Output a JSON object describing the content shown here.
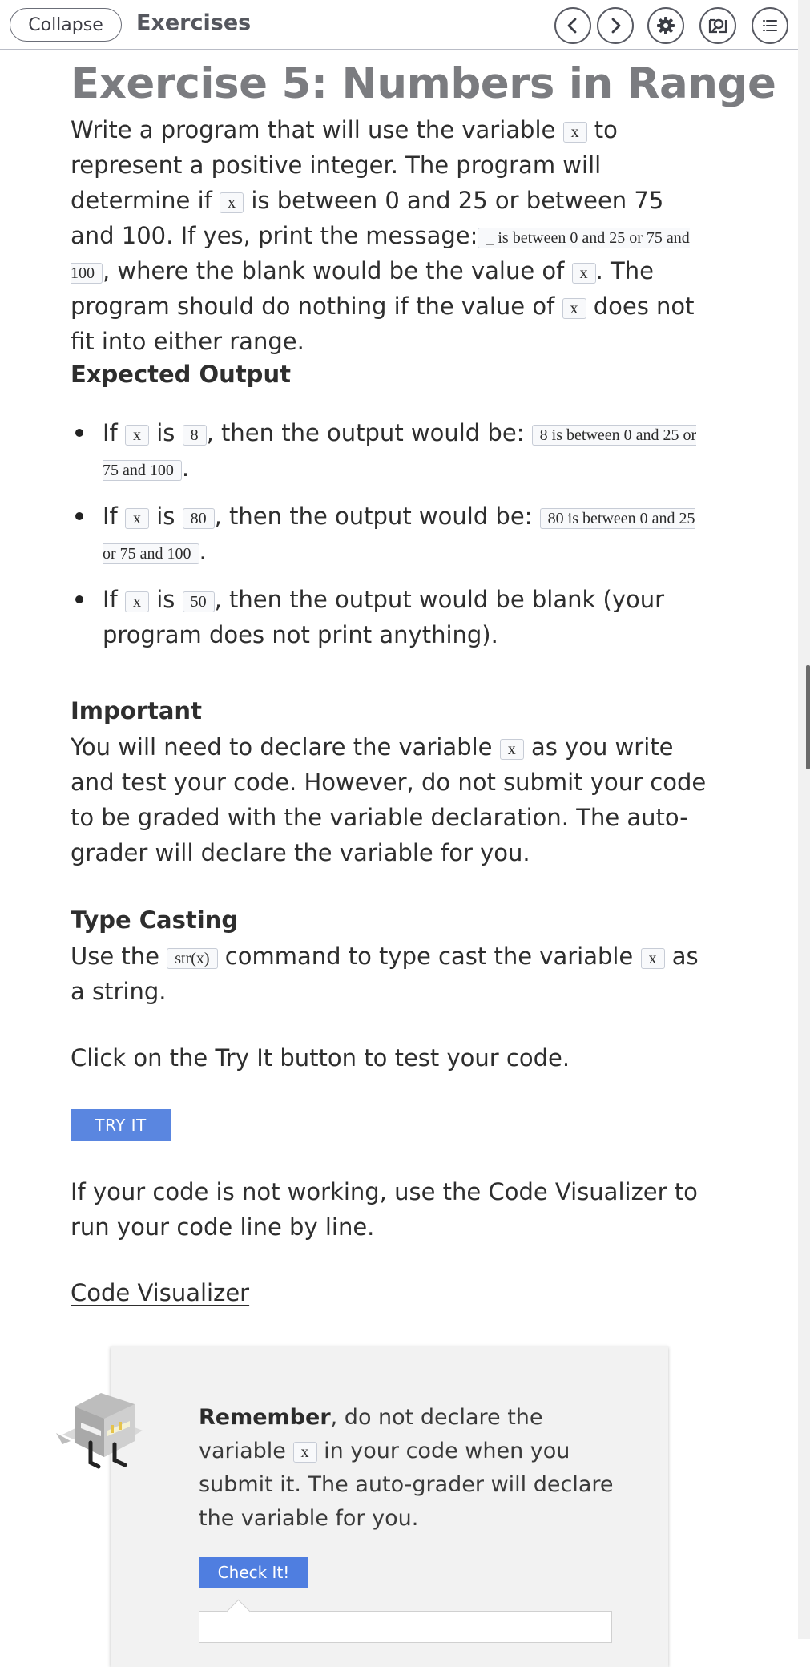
{
  "topbar": {
    "collapse_label": "Collapse",
    "title": "Exercises",
    "icons": [
      "chevron-left-icon",
      "chevron-right-icon",
      "gear-icon",
      "search-book-icon",
      "list-icon"
    ]
  },
  "exercise": {
    "title": "Exercise 5: Numbers in Range",
    "intro": {
      "t1": "Write a program that will use the variable ",
      "c1": "x",
      "t2": " to represent a positive integer. The program will determine if ",
      "c2": "x",
      "t3": " is between 0 and 25 or between 75 and 100. If yes, print the message:",
      "c3": "_ is between 0 and 25 or 75 and 100",
      "t4": ", where the blank would be the value of ",
      "c4": "x",
      "t5": ". The program should do nothing if the value of ",
      "c5": "x",
      "t6": " does not fit into either range."
    },
    "expected_heading": "Expected Output",
    "expected": [
      {
        "if": "If ",
        "var": "x",
        "is": " is ",
        "val": "8",
        "then": ", then the output would be: ",
        "out": "8 is between 0 and 25 or 75 and 100",
        "end": "."
      },
      {
        "if": "If ",
        "var": "x",
        "is": " is ",
        "val": "80",
        "then": ", then the output would be: ",
        "out": "80 is between 0 and 25 or 75 and 100",
        "end": "."
      },
      {
        "if": "If ",
        "var": "x",
        "is": " is ",
        "val": "50",
        "then": ", then the output would be blank (your program does not print anything).",
        "out": "",
        "end": ""
      }
    ],
    "important_heading": "Important",
    "important": {
      "t1": "You will need to declare the variable ",
      "c1": "x",
      "t2": " as you write and test your code. However, do not submit your code to be graded with the variable declaration. The auto-grader will declare the variable for you."
    },
    "casting_heading": "Type Casting",
    "casting": {
      "t1": "Use the ",
      "c1": "str(x)",
      "t2": " command to type cast the variable ",
      "c2": "x",
      "t3": " as a string."
    },
    "try_prompt": "Click on the Try It button to test your code.",
    "try_label": "TRY IT",
    "visualizer_prompt": "If your code is not working, use the Code Visualizer to run your code line by line.",
    "visualizer_link": "Code Visualizer"
  },
  "reminder": {
    "bold": "Remember",
    "t1": ", do not declare the variable ",
    "c1": "x",
    "t2": " in your code when you submit it. The auto-grader will declare the variable for you.",
    "check_label": "Check It!"
  }
}
